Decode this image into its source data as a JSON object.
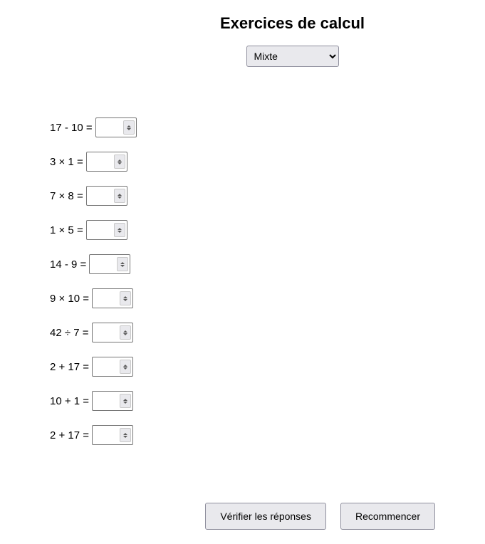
{
  "header": {
    "title": "Exercices de calcul",
    "mode_select": {
      "selected": "Mixte",
      "options": [
        "Mixte"
      ]
    }
  },
  "exercises": [
    {
      "expression": "17 - 10 = ",
      "value": ""
    },
    {
      "expression": "3 × 1 = ",
      "value": ""
    },
    {
      "expression": "7 × 8 = ",
      "value": ""
    },
    {
      "expression": "1 × 5 = ",
      "value": ""
    },
    {
      "expression": "14 - 9 = ",
      "value": ""
    },
    {
      "expression": "9 × 10 = ",
      "value": ""
    },
    {
      "expression": "42 ÷ 7 = ",
      "value": ""
    },
    {
      "expression": "2 + 17 = ",
      "value": ""
    },
    {
      "expression": "10 + 1 = ",
      "value": ""
    },
    {
      "expression": "2 + 17 = ",
      "value": ""
    }
  ],
  "buttons": {
    "verify": "Vérifier les réponses",
    "restart": "Recommencer"
  }
}
